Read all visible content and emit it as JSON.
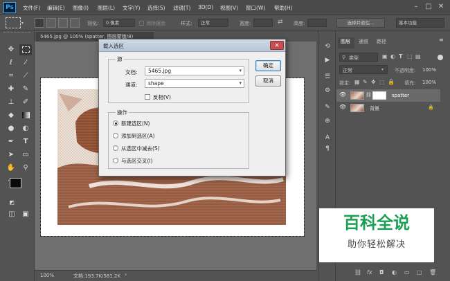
{
  "app": {
    "logo": "Ps"
  },
  "menu": [
    "文件(F)",
    "编辑(E)",
    "图像(I)",
    "图层(L)",
    "文字(Y)",
    "选择(S)",
    "滤镜(T)",
    "3D(D)",
    "视图(V)",
    "窗口(W)",
    "帮助(H)"
  ],
  "options": {
    "feather_label": "羽化:",
    "feather_value": "0 像素",
    "antialias_label": "消除锯齿",
    "style_label": "样式:",
    "style_value": "正常",
    "width_label": "宽度:",
    "height_label": "高度:",
    "select_mask_button": "选择并遮住...",
    "workspace_value": "基本功能"
  },
  "document": {
    "tab_title": "5465.jpg @ 100% (spatter, 图层蒙版/8)",
    "zoom": "100%",
    "doc_info": "文档:193.7K/581.2K"
  },
  "panel": {
    "tabs": [
      "图层",
      "通道",
      "路径"
    ],
    "kind_label": "类型",
    "blend_mode": "正常",
    "opacity_label": "不透明度:",
    "opacity_value": "100%",
    "lock_label": "锁定:",
    "fill_label": "填充:",
    "fill_value": "100%",
    "layers": [
      {
        "name": "spatter"
      },
      {
        "name": "背景"
      }
    ]
  },
  "dialog": {
    "title": "载入选区",
    "source_group": "源",
    "document_label": "文档:",
    "document_value": "5465.jpg",
    "channel_label": "通道:",
    "channel_value": "shape",
    "invert_label": "反相(V)",
    "operation_group": "操作",
    "operations": [
      "新建选区(N)",
      "添加到选区(A)",
      "从选区中减去(S)",
      "与选区交叉(I)"
    ],
    "selected_operation": 0,
    "ok_button": "确定",
    "cancel_button": "取消"
  },
  "watermark": {
    "title": "百科全说",
    "subtitle": "助你轻松解决"
  },
  "colors": {
    "accent": "#1aa053",
    "ui_dark": "#535353",
    "dialog_bg": "#efefef",
    "texture_brown": "#9a5a3e"
  }
}
